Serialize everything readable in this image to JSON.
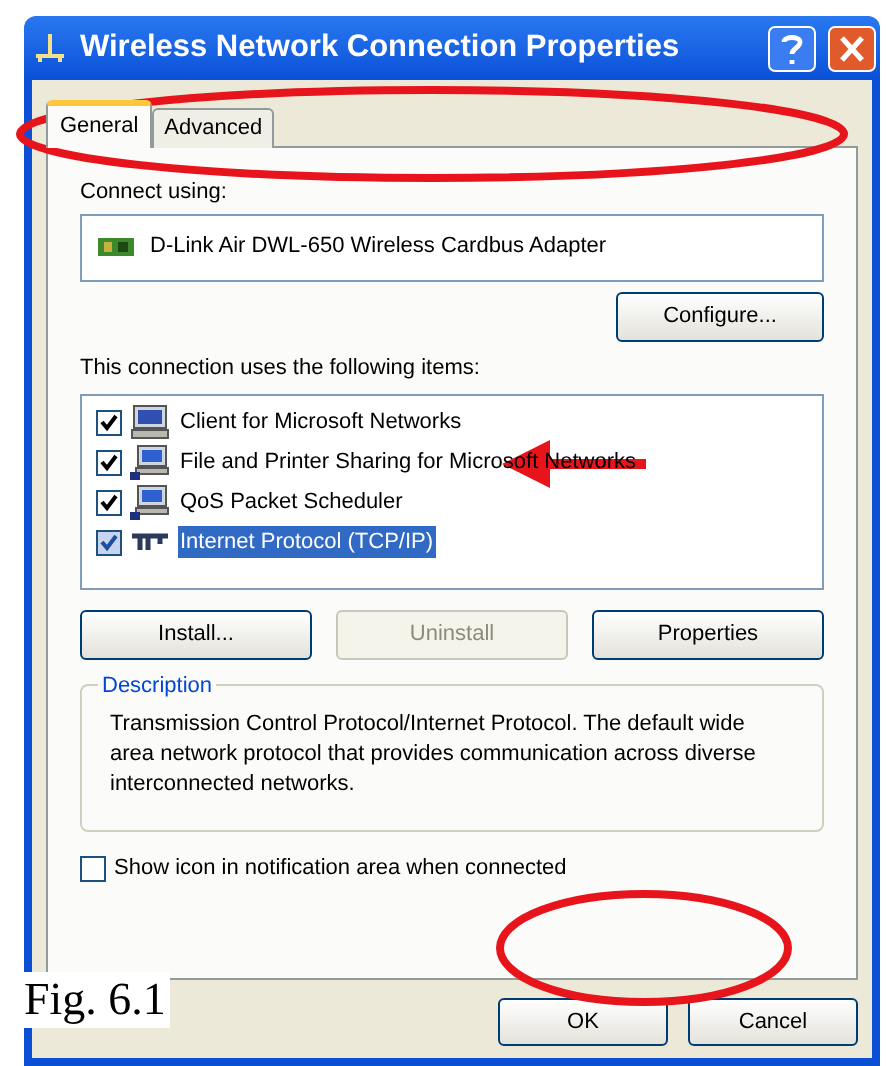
{
  "window": {
    "title": "Wireless Network Connection Properties"
  },
  "tabs": [
    {
      "label": "General",
      "selected": true
    },
    {
      "label": "Advanced",
      "selected": false
    }
  ],
  "connect_using": {
    "label": "Connect using:",
    "adapter": "D-Link Air DWL-650 Wireless Cardbus Adapter"
  },
  "configure_button": "Configure...",
  "items_label": "This connection uses the following items:",
  "items": [
    {
      "kind": "client",
      "label": "Client for Microsoft Networks",
      "checked": true,
      "selected": false
    },
    {
      "kind": "service",
      "label": "File and Printer Sharing for Microsoft Networks",
      "checked": true,
      "selected": false
    },
    {
      "kind": "service",
      "label": "QoS Packet Scheduler",
      "checked": true,
      "selected": false
    },
    {
      "kind": "protocol",
      "label": "Internet Protocol (TCP/IP)",
      "checked": true,
      "selected": true
    }
  ],
  "item_buttons": [
    {
      "label": "Install...",
      "disabled": false
    },
    {
      "label": "Uninstall",
      "disabled": true
    },
    {
      "label": "Properties",
      "disabled": false
    }
  ],
  "description": {
    "legend": "Description",
    "text": "Transmission Control Protocol/Internet Protocol. The default wide area network protocol that provides communication across diverse interconnected networks."
  },
  "notification_checkbox": {
    "label": "Show icon in notification area when connected",
    "checked": false
  },
  "dialog_buttons": [
    {
      "label": "OK"
    },
    {
      "label": "Cancel"
    }
  ],
  "caption": "Fig. 6.1"
}
